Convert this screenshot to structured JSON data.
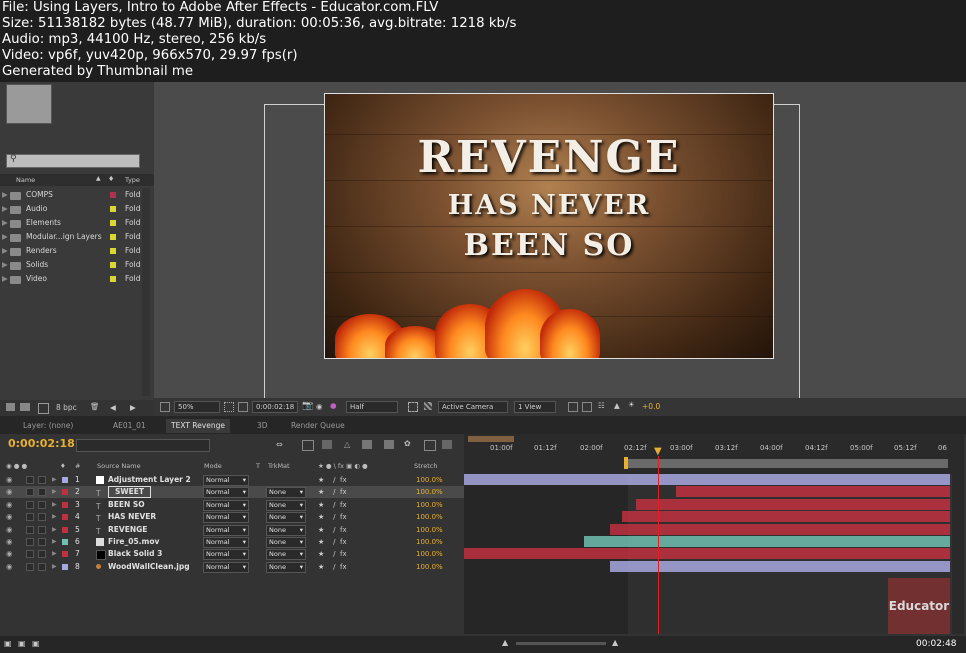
{
  "info": {
    "line1": "File: Using Layers, Intro to Adobe After Effects - Educator.com.FLV",
    "line2": "Size: 51138182 bytes (48.77 MiB), duration: 00:05:36, avg.bitrate: 1218 kb/s",
    "line3": "Audio: mp3, 44100 Hz, stereo, 256 kb/s",
    "line4": "Video: vp6f, yuv420p, 966x570, 29.97 fps(r)",
    "line5": "Generated by Thumbnail me"
  },
  "project": {
    "col_name": "Name",
    "col_type": "Type",
    "items": [
      {
        "label": "COMPS",
        "type": "Fold",
        "color": "#b03050"
      },
      {
        "label": "Audio",
        "type": "Fold",
        "color": "#d8d830"
      },
      {
        "label": "Elements",
        "type": "Fold",
        "color": "#d8d830"
      },
      {
        "label": "Modular...ign Layers",
        "type": "Fold",
        "color": "#d8d830"
      },
      {
        "label": "Renders",
        "type": "Fold",
        "color": "#d8d830"
      },
      {
        "label": "Solids",
        "type": "Fold",
        "color": "#d8d830"
      },
      {
        "label": "Video",
        "type": "Fold",
        "color": "#d8d830"
      }
    ],
    "bpc": "8 bpc"
  },
  "viewer": {
    "headline1": "REVENGE",
    "headline2": "HAS NEVER",
    "headline3": "BEEN SO",
    "zoom": "50%",
    "time": "0:00:02:18",
    "resolution": "Half",
    "camera": "Active Camera",
    "views": "1 View",
    "exposure": "+0.0"
  },
  "tabs": {
    "layer": "Layer: (none)",
    "ae": "AE01_01",
    "text": "TEXT Revenge",
    "three_d": "3D",
    "render": "Render Queue"
  },
  "timeline": {
    "timecode": "0:00:02:18",
    "col_num": "#",
    "col_source": "Source Name",
    "col_mode": "Mode",
    "col_t": "T",
    "col_trkmat": "TrkMat",
    "col_stretch": "Stretch",
    "ruler": [
      "01:00f",
      "01:12f",
      "02:00f",
      "02:12f",
      "03:00f",
      "03:12f",
      "04:00f",
      "04:12f",
      "05:00f",
      "05:12f",
      "06"
    ],
    "layers": [
      {
        "num": "1",
        "name": "Adjustment Layer 2",
        "mode": "Normal",
        "trkmat": "",
        "stretch": "100.0%",
        "color": "#a8a8e0",
        "icon": "white-solid-icon"
      },
      {
        "num": "2",
        "name": "SWEET",
        "mode": "Normal",
        "trkmat": "None",
        "stretch": "100.0%",
        "color": "#c03040",
        "icon": "text-icon"
      },
      {
        "num": "3",
        "name": "BEEN SO",
        "mode": "Normal",
        "trkmat": "None",
        "stretch": "100.0%",
        "color": "#c03040",
        "icon": "text-icon"
      },
      {
        "num": "4",
        "name": "HAS NEVER",
        "mode": "Normal",
        "trkmat": "None",
        "stretch": "100.0%",
        "color": "#c03040",
        "icon": "text-icon"
      },
      {
        "num": "5",
        "name": "REVENGE",
        "mode": "Normal",
        "trkmat": "None",
        "stretch": "100.0%",
        "color": "#c03040",
        "icon": "text-icon"
      },
      {
        "num": "6",
        "name": "Fire_05.mov",
        "mode": "Normal",
        "trkmat": "None",
        "stretch": "100.0%",
        "color": "#70c0b0",
        "icon": "footage-icon"
      },
      {
        "num": "7",
        "name": "Black Solid 3",
        "mode": "Normal",
        "trkmat": "None",
        "stretch": "100.0%",
        "color": "#c03040",
        "icon": "black-solid-icon"
      },
      {
        "num": "8",
        "name": "WoodWallClean.jpg",
        "mode": "Normal",
        "trkmat": "None",
        "stretch": "100.0%",
        "color": "#a8a8e0",
        "icon": "image-icon"
      }
    ],
    "watermark": "Educator",
    "elapsed": "00:02:48"
  }
}
